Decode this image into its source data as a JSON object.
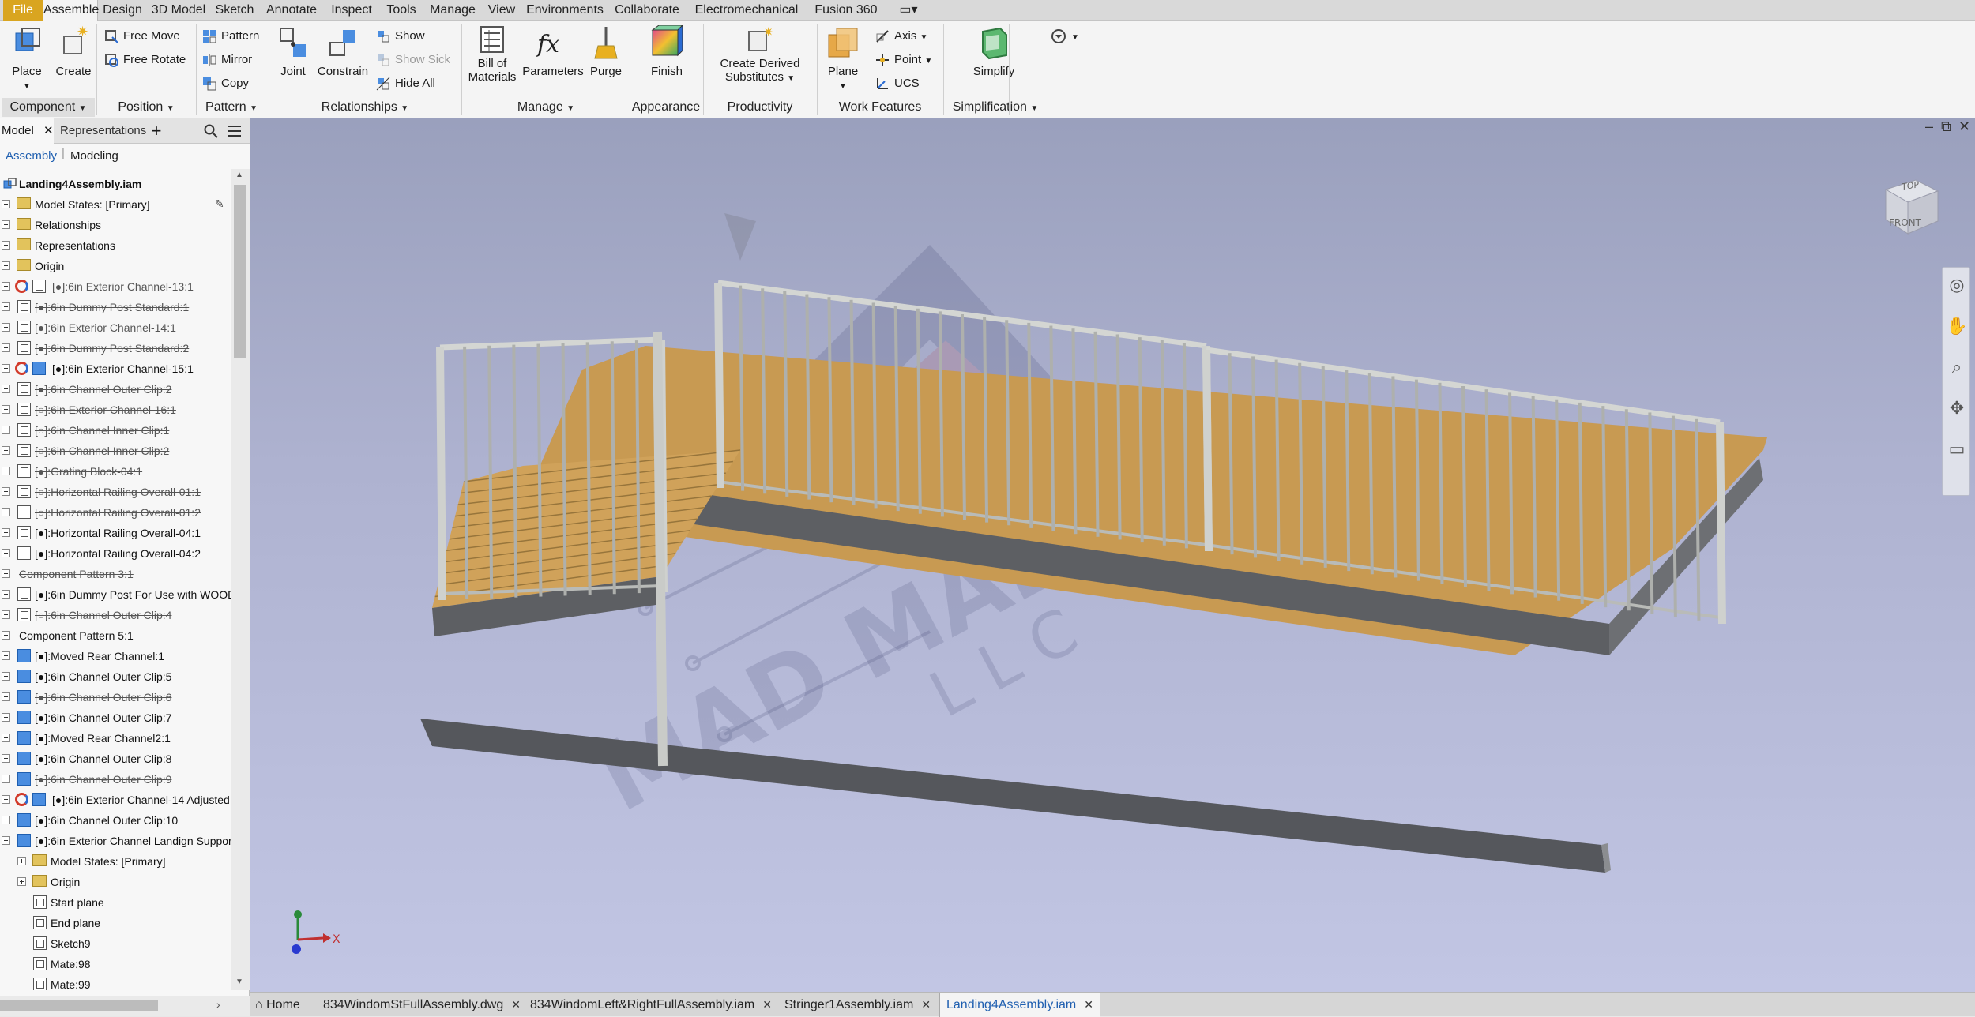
{
  "menu": {
    "items": [
      "File",
      "Assemble",
      "Design",
      "3D Model",
      "Sketch",
      "Annotate",
      "Inspect",
      "Tools",
      "Manage",
      "View",
      "Environments",
      "Collaborate",
      "Electromechanical",
      "Fusion 360"
    ],
    "active": "Assemble"
  },
  "ribbon": {
    "component": {
      "place": "Place",
      "create": "Create",
      "panel": "Component"
    },
    "position": {
      "free_move": "Free Move",
      "free_rotate": "Free Rotate",
      "panel": "Position"
    },
    "pattern": {
      "pattern": "Pattern",
      "mirror": "Mirror",
      "copy": "Copy",
      "panel": "Pattern"
    },
    "relationships": {
      "joint": "Joint",
      "constrain": "Constrain",
      "show": "Show",
      "show_sick": "Show Sick",
      "hide_all": "Hide All",
      "panel": "Relationships"
    },
    "manage": {
      "bom_line1": "Bill of",
      "bom_line2": "Materials",
      "parameters": "Parameters",
      "purge": "Purge",
      "panel": "Manage"
    },
    "appearance": {
      "finish": "Finish",
      "panel": "Appearance"
    },
    "productivity": {
      "derived_line1": "Create Derived",
      "derived_line2": "Substitutes",
      "panel": "Productivity"
    },
    "work_features": {
      "plane": "Plane",
      "axis": "Axis",
      "point": "Point",
      "ucs": "UCS",
      "panel": "Work Features"
    },
    "simplification": {
      "simplify": "Simplify",
      "panel": "Simplification"
    }
  },
  "browser": {
    "tab_model": "Model",
    "tab_representations": "Representations",
    "subtab_assembly": "Assembly",
    "subtab_modeling": "Modeling",
    "root": "Landing4Assembly.iam",
    "items": [
      {
        "label": "Model States: [Primary]",
        "icon": "folder",
        "level": 0,
        "strike": false,
        "expander": "plus"
      },
      {
        "label": "Relationships",
        "icon": "folder",
        "level": 0,
        "strike": false,
        "expander": "plus"
      },
      {
        "label": "Representations",
        "icon": "representations",
        "level": 0,
        "strike": false,
        "expander": "plus"
      },
      {
        "label": "Origin",
        "icon": "folder",
        "level": 0,
        "strike": false,
        "expander": "plus"
      },
      {
        "label": "[●]:6in Exterior Channel-13:1",
        "icon": "refresh-component",
        "level": 0,
        "strike": true,
        "expander": "plus"
      },
      {
        "label": "[●]:6in Dummy Post Standard:1",
        "icon": "component",
        "level": 0,
        "strike": true,
        "expander": "plus"
      },
      {
        "label": "[●]:6in Exterior Channel-14:1",
        "icon": "component",
        "level": 0,
        "strike": true,
        "expander": "plus"
      },
      {
        "label": "[●]:6in Dummy Post Standard:2",
        "icon": "component",
        "level": 0,
        "strike": true,
        "expander": "plus"
      },
      {
        "label": "[●]:6in Exterior Channel-15:1",
        "icon": "refresh-part",
        "level": 0,
        "strike": false,
        "expander": "plus"
      },
      {
        "label": "[●]:6in Channel Outer Clip:2",
        "icon": "component",
        "level": 0,
        "strike": true,
        "expander": "plus"
      },
      {
        "label": "[○]:6in Exterior Channel-16:1",
        "icon": "component",
        "level": 0,
        "strike": true,
        "expander": "plus"
      },
      {
        "label": "[○]:6in Channel Inner Clip:1",
        "icon": "component",
        "level": 0,
        "strike": true,
        "expander": "plus"
      },
      {
        "label": "[○]:6in Channel Inner Clip:2",
        "icon": "component",
        "level": 0,
        "strike": true,
        "expander": "plus"
      },
      {
        "label": "[●]:Grating Block-04:1",
        "icon": "component",
        "level": 0,
        "strike": true,
        "expander": "plus"
      },
      {
        "label": "[○]:Horizontal Railing Overall-01:1",
        "icon": "component",
        "level": 0,
        "strike": true,
        "expander": "plus"
      },
      {
        "label": "[○]:Horizontal Railing Overall-01:2",
        "icon": "component",
        "level": 0,
        "strike": true,
        "expander": "plus"
      },
      {
        "label": "[●]:Horizontal Railing Overall-04:1",
        "icon": "component",
        "level": 0,
        "strike": false,
        "expander": "plus"
      },
      {
        "label": "[●]:Horizontal Railing Overall-04:2",
        "icon": "component",
        "level": 0,
        "strike": false,
        "expander": "plus"
      },
      {
        "label": "Component Pattern 3:1",
        "icon": "none",
        "level": 0,
        "strike": true,
        "expander": "plus"
      },
      {
        "label": "[●]:6in Dummy Post For Use with WOOD",
        "icon": "component",
        "level": 0,
        "strike": false,
        "expander": "plus"
      },
      {
        "label": "[○]:6in Channel Outer Clip:4",
        "icon": "component",
        "level": 0,
        "strike": true,
        "expander": "plus"
      },
      {
        "label": "Component Pattern 5:1",
        "icon": "none",
        "level": 0,
        "strike": false,
        "expander": "plus"
      },
      {
        "label": "[●]:Moved Rear Channel:1",
        "icon": "part-edit",
        "level": 0,
        "strike": false,
        "expander": "plus"
      },
      {
        "label": "[●]:6in Channel Outer Clip:5",
        "icon": "part-edit",
        "level": 0,
        "strike": false,
        "expander": "plus"
      },
      {
        "label": "[●]:6in Channel Outer Clip:6",
        "icon": "part",
        "level": 0,
        "strike": true,
        "expander": "plus"
      },
      {
        "label": "[●]:6in Channel Outer Clip:7",
        "icon": "part",
        "level": 0,
        "strike": false,
        "expander": "plus"
      },
      {
        "label": "[●]:Moved Rear Channel2:1",
        "icon": "part",
        "level": 0,
        "strike": false,
        "expander": "plus"
      },
      {
        "label": "[●]:6in Channel Outer Clip:8",
        "icon": "part",
        "level": 0,
        "strike": false,
        "expander": "plus"
      },
      {
        "label": "[●]:6in Channel Outer Clip:9",
        "icon": "part",
        "level": 0,
        "strike": true,
        "expander": "plus"
      },
      {
        "label": "[●]:6in Exterior Channel-14 Adjusted",
        "icon": "refresh-part",
        "level": 0,
        "strike": false,
        "expander": "plus"
      },
      {
        "label": "[●]:6in Channel Outer Clip:10",
        "icon": "part",
        "level": 0,
        "strike": false,
        "expander": "plus"
      },
      {
        "label": "[●]:6in Exterior Channel Landign Suppor",
        "icon": "part",
        "level": 0,
        "strike": false,
        "expander": "minus"
      },
      {
        "label": "Model States: [Primary]",
        "icon": "folder",
        "level": 1,
        "strike": false,
        "expander": "plus"
      },
      {
        "label": "Origin",
        "icon": "folder",
        "level": 1,
        "strike": false,
        "expander": "plus"
      },
      {
        "label": "Start plane",
        "icon": "plane",
        "level": 1,
        "strike": false,
        "expander": "none"
      },
      {
        "label": "End plane",
        "icon": "plane",
        "level": 1,
        "strike": false,
        "expander": "none"
      },
      {
        "label": "Sketch9",
        "icon": "sketch",
        "level": 1,
        "strike": false,
        "expander": "none"
      },
      {
        "label": "Mate:98",
        "icon": "mate",
        "level": 1,
        "strike": false,
        "expander": "none"
      },
      {
        "label": "Mate:99",
        "icon": "mate",
        "level": 1,
        "strike": false,
        "expander": "none"
      }
    ]
  },
  "viewcube": {
    "top": "TOP",
    "front": "FRONT"
  },
  "triad": {
    "x": "X"
  },
  "watermark": {
    "text": "MAD MADE",
    "sub": "L L C"
  },
  "doc_tabs": {
    "home": "Home",
    "tabs": [
      {
        "label": "834WindomStFullAssembly.dwg",
        "active": false
      },
      {
        "label": "834WindomLeft&RightFullAssembly.iam",
        "active": false
      },
      {
        "label": "Stringer1Assembly.iam",
        "active": false
      },
      {
        "label": "Landing4Assembly.iam",
        "active": true
      }
    ]
  },
  "colors": {
    "file_menu": "#d9a520",
    "wood": "#c89a52",
    "rail": "#c9cbc8",
    "channel": "#5d5f63",
    "viewport_top": "#9aa0bd",
    "viewport_bottom": "#c2c6e4"
  }
}
